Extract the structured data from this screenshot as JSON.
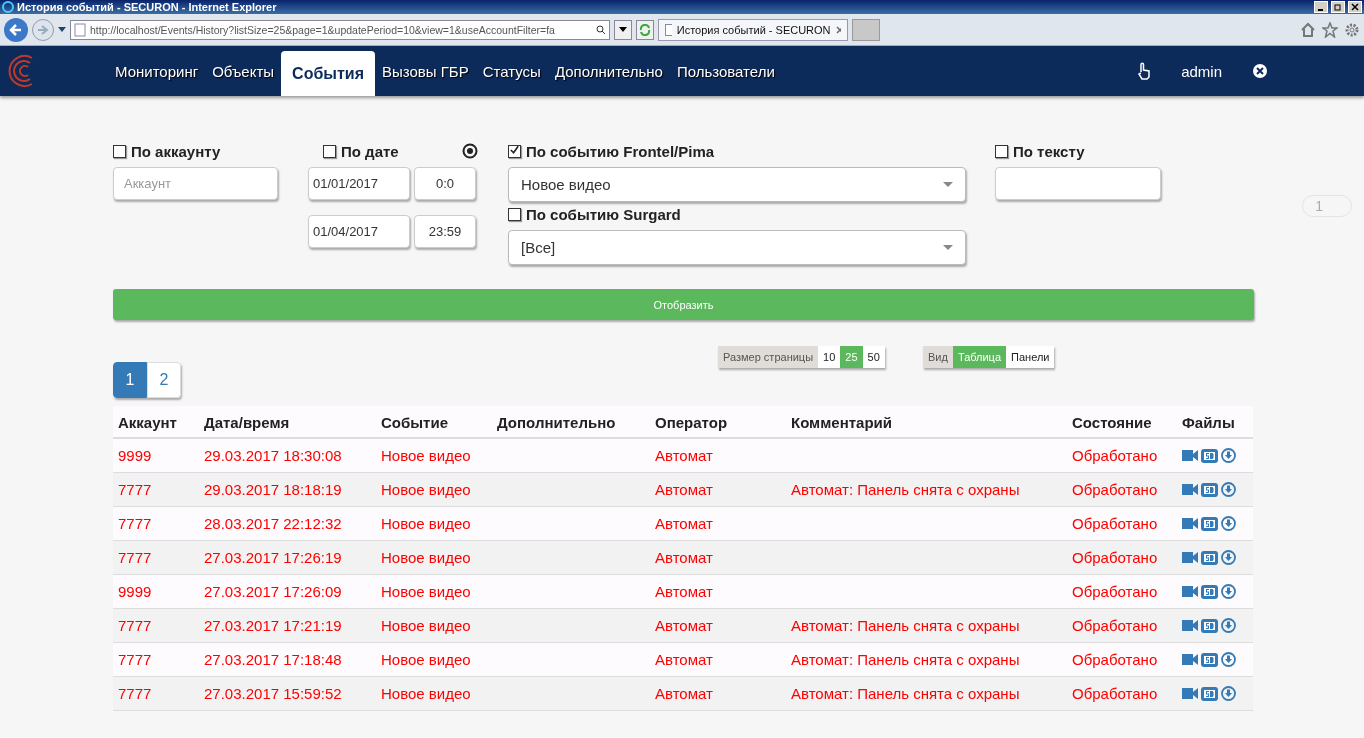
{
  "browser": {
    "title": "История событий - SECURON - Internet Explorer",
    "url": "http://localhost/Events/History?listSize=25&page=1&updatePeriod=10&view=1&useAccountFilter=fa",
    "tab_title": "История событий - SECURON"
  },
  "nav": {
    "items": [
      {
        "label": "Мониторинг",
        "selected": false
      },
      {
        "label": "Объекты",
        "selected": false
      },
      {
        "label": "События",
        "selected": true
      },
      {
        "label": "Вызовы ГБР",
        "selected": false
      },
      {
        "label": "Статусы",
        "selected": false
      },
      {
        "label": "Дополнительно",
        "selected": false
      },
      {
        "label": "Пользователи",
        "selected": false
      }
    ],
    "user": "admin"
  },
  "filters": {
    "account": {
      "label": "По аккаунту",
      "checked": false,
      "placeholder": "Аккаунт"
    },
    "date": {
      "label": "По дате",
      "checked": false,
      "from_date": "01/01/2017",
      "from_time": "0:0",
      "to_date": "01/04/2017",
      "to_time": "23:59"
    },
    "frontel": {
      "label": "По событию Frontel/Pima",
      "checked": true,
      "value": "Новое видео"
    },
    "surgard": {
      "label": "По событию Surgard",
      "checked": false,
      "value": "[Все]"
    },
    "text": {
      "label": "По тексту",
      "checked": false
    }
  },
  "show_button": "Отобразить",
  "page_size": {
    "label": "Размер страницы",
    "options": [
      {
        "label": "10",
        "selected": false
      },
      {
        "label": "25",
        "selected": true
      },
      {
        "label": "50",
        "selected": false
      }
    ]
  },
  "view": {
    "label": "Вид",
    "options": [
      {
        "label": "Таблица",
        "selected": true
      },
      {
        "label": "Панели",
        "selected": false
      }
    ]
  },
  "pagination": [
    {
      "label": "1",
      "selected": true
    },
    {
      "label": "2",
      "selected": false
    }
  ],
  "side_pager": "1",
  "table": {
    "columns": [
      "Аккаунт",
      "Дата/время",
      "Событие",
      "Дополнительно",
      "Оператор",
      "Комментарий",
      "Состояние",
      "Файлы"
    ],
    "rows": [
      {
        "account": "9999",
        "datetime": "29.03.2017 18:30:08",
        "event": "Новое видео",
        "operator": "Автомат",
        "status": "Обработано"
      },
      {
        "account": "7777",
        "datetime": "29.03.2017 18:18:19",
        "event": "Новое видео",
        "operator": "Автомат",
        "comment": "Автомат: Панель снята с охраны",
        "status": "Обработано"
      },
      {
        "account": "7777",
        "datetime": "28.03.2017 22:12:32",
        "event": "Новое видео",
        "operator": "Автомат",
        "status": "Обработано"
      },
      {
        "account": "7777",
        "datetime": "27.03.2017 17:26:19",
        "event": "Новое видео",
        "operator": "Автомат",
        "status": "Обработано"
      },
      {
        "account": "9999",
        "datetime": "27.03.2017 17:26:09",
        "event": "Новое видео",
        "operator": "Автомат",
        "status": "Обработано"
      },
      {
        "account": "7777",
        "datetime": "27.03.2017 17:21:19",
        "event": "Новое видео",
        "operator": "Автомат",
        "comment": "Автомат: Панель снята с охраны",
        "status": "Обработано"
      },
      {
        "account": "7777",
        "datetime": "27.03.2017 17:18:48",
        "event": "Новое видео",
        "operator": "Автомат",
        "comment": "Автомат: Панель снята с охраны",
        "status": "Обработано"
      },
      {
        "account": "7777",
        "datetime": "27.03.2017 15:59:52",
        "event": "Новое видео",
        "operator": "Автомат",
        "comment": "Автомат: Панель снята с охраны",
        "status": "Обработано"
      }
    ]
  }
}
